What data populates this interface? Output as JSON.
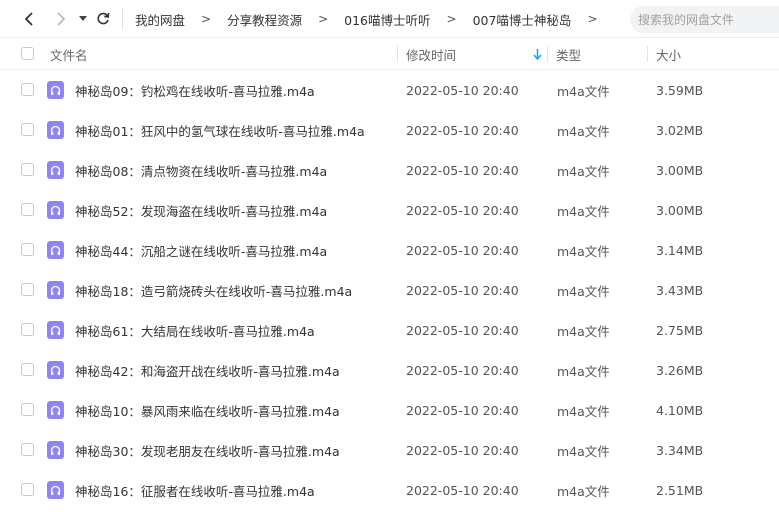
{
  "breadcrumb": [
    "我的网盘",
    "分享教程资源",
    "016喵博士听听",
    "007喵博士神秘岛"
  ],
  "search": {
    "placeholder": "搜索我的网盘文件"
  },
  "columns": {
    "name": "文件名",
    "modified": "修改时间",
    "type": "类型",
    "size": "大小"
  },
  "files": [
    {
      "name": "神秘岛09：钓松鸡在线收听-喜马拉雅.m4a",
      "date": "2022-05-10 20:40",
      "type": "m4a文件",
      "size": "3.59MB"
    },
    {
      "name": "神秘岛01：狂风中的氢气球在线收听-喜马拉雅.m4a",
      "date": "2022-05-10 20:40",
      "type": "m4a文件",
      "size": "3.02MB"
    },
    {
      "name": "神秘岛08：清点物资在线收听-喜马拉雅.m4a",
      "date": "2022-05-10 20:40",
      "type": "m4a文件",
      "size": "3.00MB"
    },
    {
      "name": "神秘岛52：发现海盗在线收听-喜马拉雅.m4a",
      "date": "2022-05-10 20:40",
      "type": "m4a文件",
      "size": "3.00MB"
    },
    {
      "name": "神秘岛44：沉船之谜在线收听-喜马拉雅.m4a",
      "date": "2022-05-10 20:40",
      "type": "m4a文件",
      "size": "3.14MB"
    },
    {
      "name": "神秘岛18：造弓箭烧砖头在线收听-喜马拉雅.m4a",
      "date": "2022-05-10 20:40",
      "type": "m4a文件",
      "size": "3.43MB"
    },
    {
      "name": "神秘岛61：大结局在线收听-喜马拉雅.m4a",
      "date": "2022-05-10 20:40",
      "type": "m4a文件",
      "size": "2.75MB"
    },
    {
      "name": "神秘岛42：和海盗开战在线收听-喜马拉雅.m4a",
      "date": "2022-05-10 20:40",
      "type": "m4a文件",
      "size": "3.26MB"
    },
    {
      "name": "神秘岛10：暴风雨来临在线收听-喜马拉雅.m4a",
      "date": "2022-05-10 20:40",
      "type": "m4a文件",
      "size": "4.10MB"
    },
    {
      "name": "神秘岛30：发现老朋友在线收听-喜马拉雅.m4a",
      "date": "2022-05-10 20:40",
      "type": "m4a文件",
      "size": "3.34MB"
    },
    {
      "name": "神秘岛16：征服者在线收听-喜马拉雅.m4a",
      "date": "2022-05-10 20:40",
      "type": "m4a文件",
      "size": "2.51MB"
    }
  ],
  "icons": {
    "file": "audio-file-icon",
    "sort": "sort-desc-arrow-icon"
  },
  "colors": {
    "accent": "#06a7ff",
    "file_icon": "#8e84f2"
  }
}
